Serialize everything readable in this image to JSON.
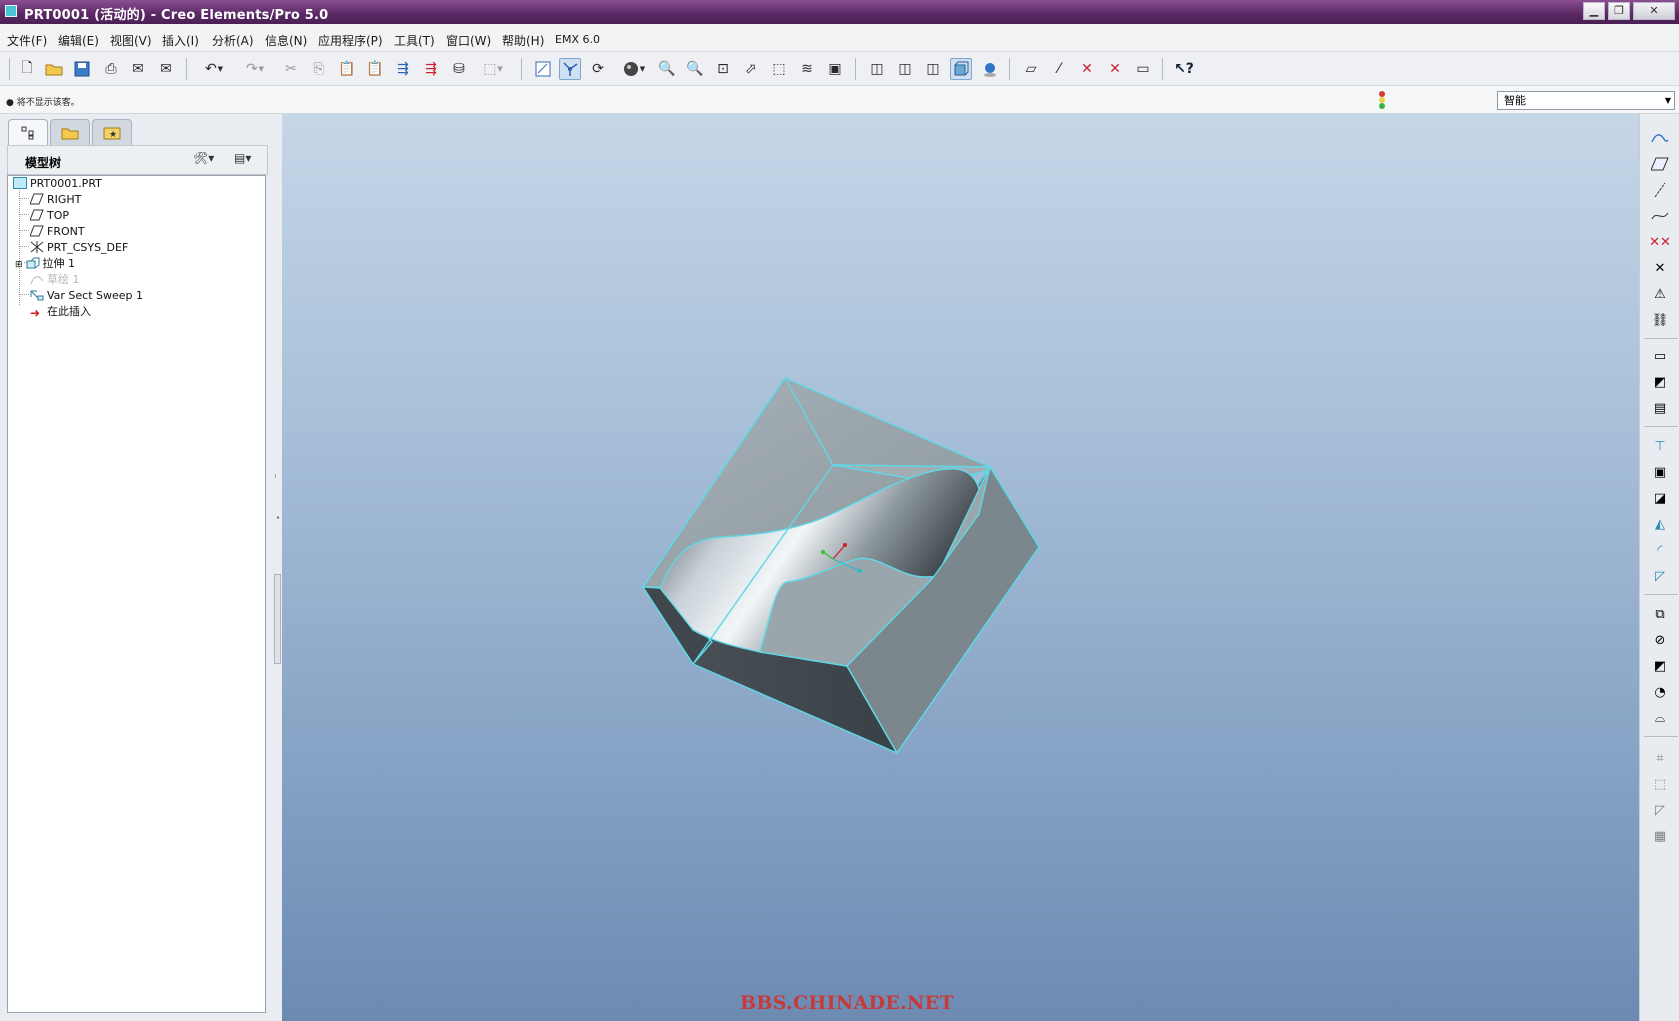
{
  "window": {
    "title": "PRT0001 (活动的) - Creo Elements/Pro 5.0",
    "buttons": [
      "minimize",
      "restore",
      "close"
    ]
  },
  "menubar": [
    {
      "label": "文件(F)"
    },
    {
      "label": "编辑(E)"
    },
    {
      "label": "视图(V)"
    },
    {
      "label": "插入(I)"
    },
    {
      "label": "分析(A)"
    },
    {
      "label": "信息(N)"
    },
    {
      "label": "应用程序(P)"
    },
    {
      "label": "工具(T)"
    },
    {
      "label": "窗口(W)"
    },
    {
      "label": "帮助(H)"
    },
    {
      "label": "EMX 6.0"
    }
  ],
  "toolbar": {
    "icons": [
      "new-file-icon",
      "open-file-icon",
      "save-icon",
      "print-icon",
      "send-mail-icon",
      "mail-attach-icon",
      "undo-icon",
      "redo-icon",
      "cut-icon",
      "copy-icon",
      "paste-icon",
      "paste-special-icon",
      "regenerate-icon",
      "regen-manager-icon",
      "find-icon",
      "select-box-icon",
      "redraw-icon",
      "spin-center-icon",
      "orient-mode-icon",
      "appearance-icon",
      "zoom-in-icon",
      "zoom-out-icon",
      "refit-icon",
      "reorient-icon",
      "saved-views-icon",
      "layers-icon",
      "view-manager-icon",
      "wireframe-icon",
      "hidden-line-icon",
      "no-hidden-icon",
      "shading-icon",
      "enhanced-realism-icon",
      "datum-plane-display-icon",
      "datum-axis-display-icon",
      "point-display-icon",
      "csys-display-icon",
      "annotation-display-icon",
      "context-help-icon"
    ]
  },
  "status": {
    "message": "● 将不显示该客。",
    "filter_value": "智能",
    "colors": {
      "light_red": "#d23b2b",
      "light_green": "#3cb043"
    }
  },
  "navigator": {
    "tabs": [
      "model-tree-tab",
      "folder-browser-tab",
      "favorites-tab"
    ],
    "header_title": "模型树",
    "tree": [
      {
        "label": "PRT0001.PRT",
        "icon": "part-icon",
        "dim": false
      },
      {
        "label": "RIGHT",
        "icon": "datum-plane-icon",
        "dim": false
      },
      {
        "label": "TOP",
        "icon": "datum-plane-icon",
        "dim": false
      },
      {
        "label": "FRONT",
        "icon": "datum-plane-icon",
        "dim": false
      },
      {
        "label": "PRT_CSYS_DEF",
        "icon": "csys-icon",
        "dim": false
      },
      {
        "label": "拉伸 1",
        "icon": "extrude-icon",
        "dim": false,
        "expandable": true
      },
      {
        "label": "草绘 1",
        "icon": "sketch-icon",
        "dim": true
      },
      {
        "label": "Var Sect Sweep 1",
        "icon": "var-sect-sweep-icon",
        "dim": false
      },
      {
        "label": "在此插入",
        "icon": "insert-here-arrow-icon",
        "dim": false
      }
    ]
  },
  "graphics": {
    "watermark": "BBS.CHINADE.NET",
    "model_colors": {
      "edge": "#5fd8e6",
      "top_face": "#9ba6ae",
      "side_dark": "#4f585e",
      "side_light": "#7b868d"
    }
  },
  "righttools": {
    "icons": [
      "sketch-tool-icon",
      "datum-plane-tool-icon",
      "datum-axis-tool-icon",
      "datum-curve-tool-icon",
      "datum-point-tool-icon",
      "csys-tool-icon",
      "analysis-feature-icon",
      "pattern-chain-icon",
      "extrude-tool-icon",
      "revolve-tool-icon",
      "sweep-tool-icon",
      "hole-tool-icon",
      "shell-tool-icon",
      "rib-tool-icon",
      "draft-tool-icon",
      "round-tool-icon",
      "chamfer-tool-icon",
      "copy-tool-icon",
      "mirror-tool-icon",
      "merge-tool-icon",
      "trim-tool-icon",
      "pattern-tool-icon",
      "intersect-tool-icon",
      "extend-tool-icon",
      "offset-tool-icon",
      "thicken-tool-icon"
    ]
  }
}
